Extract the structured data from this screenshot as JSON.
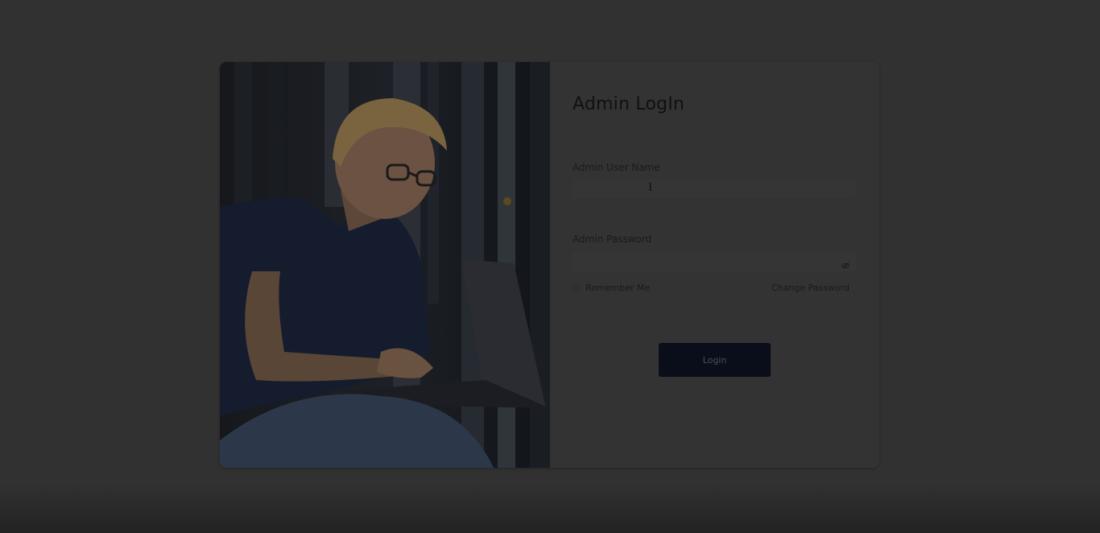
{
  "login_form": {
    "title": "Admin LogIn",
    "username": {
      "label": "Admin User Name",
      "value": "",
      "placeholder": ""
    },
    "password": {
      "label": "Admin Password",
      "value": "",
      "placeholder": ""
    },
    "remember_label": "Remember Me",
    "change_password_label": "Change Password",
    "login_label": "Login"
  },
  "photo": {
    "subject": "person with glasses using a laptop"
  },
  "colors": {
    "overlay_background": "#313131",
    "login_button": "#0a0e1a"
  }
}
